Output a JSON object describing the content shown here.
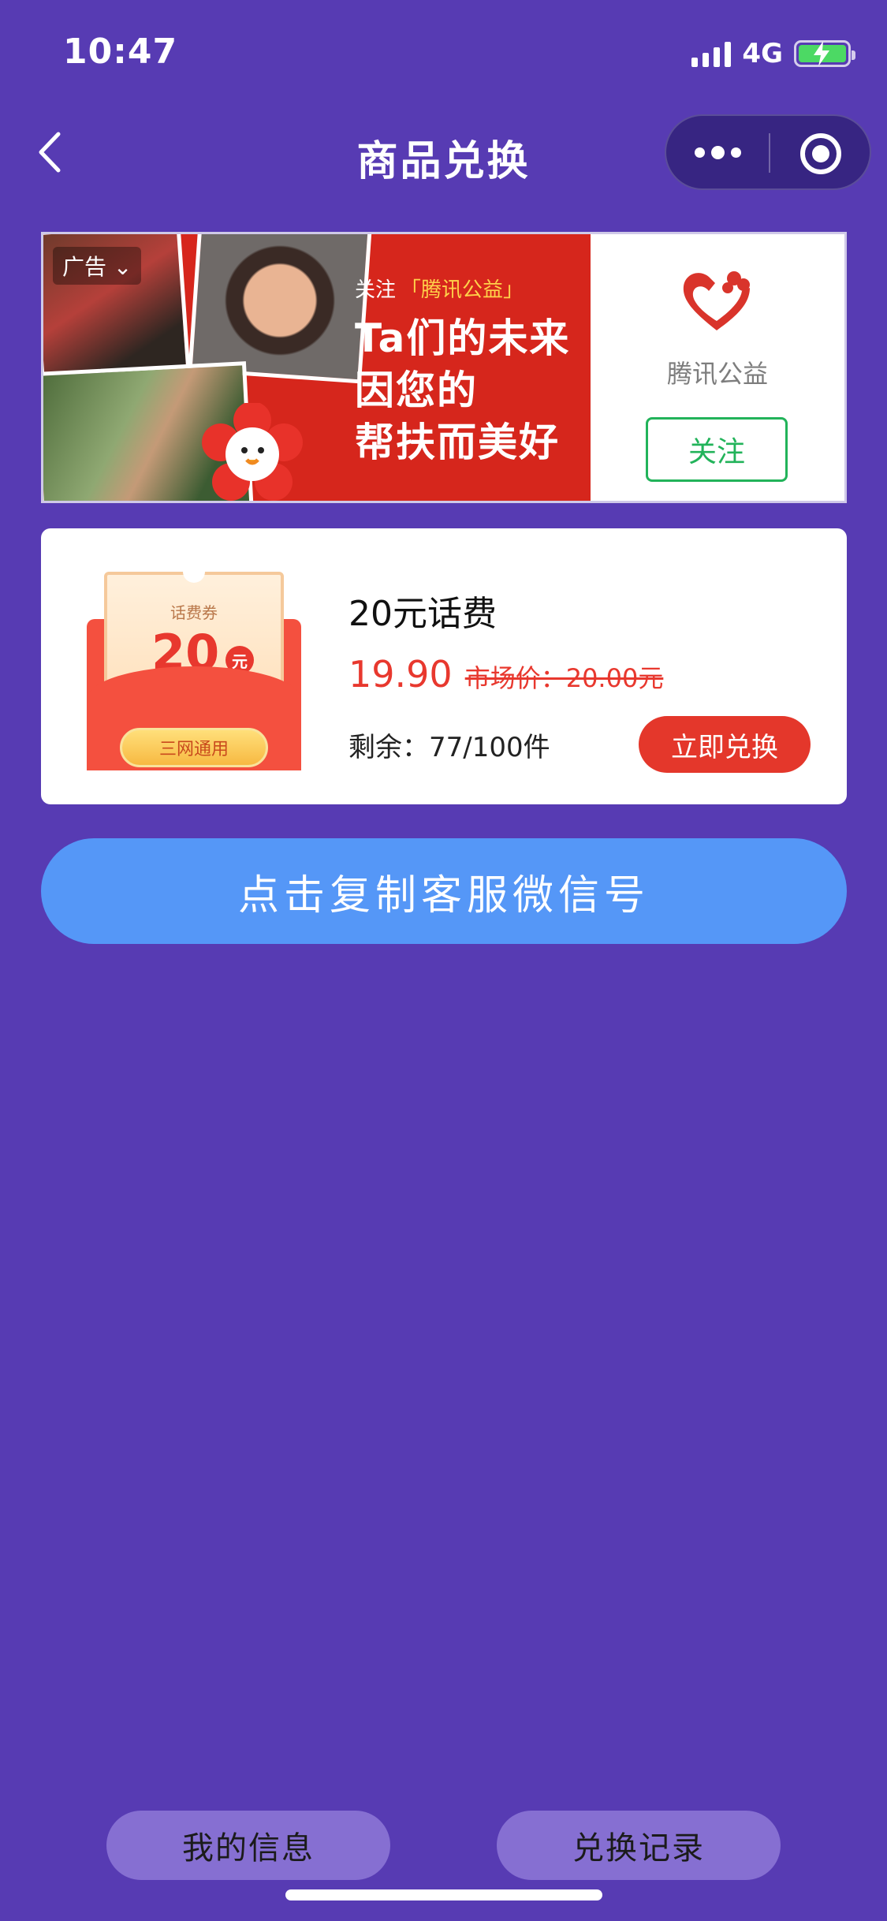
{
  "status_bar": {
    "time": "10:47",
    "network": "4G"
  },
  "nav": {
    "title": "商品兑换",
    "back_icon": "chevron-left-icon",
    "more_icon": "more-dots-icon",
    "close_icon": "target-close-icon"
  },
  "ad": {
    "badge": "广告",
    "follow_prefix": "关注",
    "follow_brand": "「腾讯公益」",
    "headline_lines": [
      "Ta们的未来",
      "因您的",
      "帮扶而美好"
    ],
    "advertiser": "腾讯公益",
    "follow_button": "关注"
  },
  "product": {
    "coupon": {
      "label": "话费券",
      "amount": "20",
      "unit": "元",
      "tag": "三网通用"
    },
    "name": "20元话费",
    "price": "19.90",
    "market_price": "市场价：20.00元",
    "stock": "剩余：77/100件",
    "redeem_button": "立即兑换"
  },
  "copy_button": "点击复制客服微信号",
  "tabs": {
    "my_info": "我的信息",
    "records": "兑换记录"
  },
  "colors": {
    "background": "#573bb3",
    "accent_red": "#e4372b",
    "blue_button": "#5597f7",
    "follow_green": "#22b35a"
  }
}
